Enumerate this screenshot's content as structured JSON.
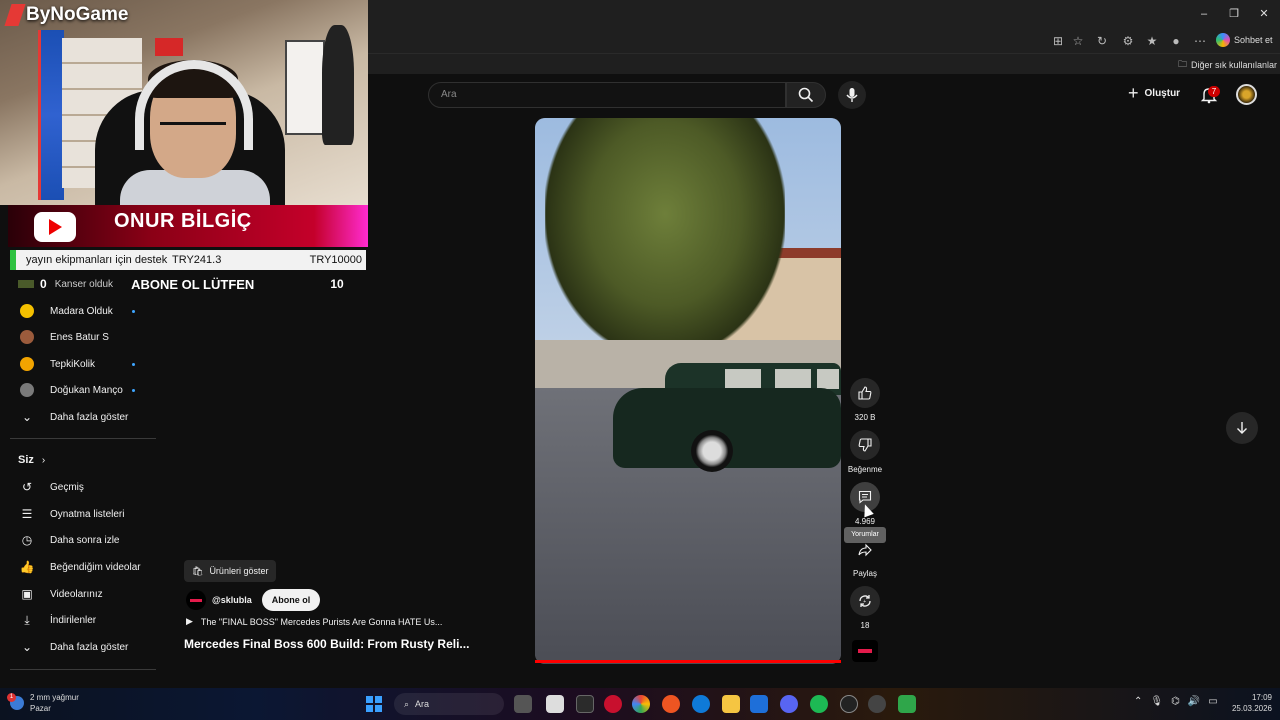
{
  "overlay": {
    "brand": "ByNoGame",
    "streamer_name": "ONUR BİLGİÇ",
    "donation_goal": "yayın ekipmanları için destek",
    "donation_current": "TRY241.3",
    "donation_target": "TRY10000",
    "sub_count_left": "0",
    "sub_goal_label": "Kanser olduk",
    "sub_cta": "ABONE OL LÜTFEN",
    "sub_count_right": "10"
  },
  "browser": {
    "copilot_label": "Sohbet et",
    "other_bookmarks": "Diğer sık kullanılanlar"
  },
  "header": {
    "search_placeholder": "Ara",
    "create_label": "Oluştur",
    "notification_count": "7"
  },
  "sidebar": {
    "subscriptions": [
      {
        "label": "Madara Olduk",
        "live": true,
        "color": "#f4c000"
      },
      {
        "label": "Enes Batur S",
        "live": false,
        "color": "#9b5b3c"
      },
      {
        "label": "TepkiKolik",
        "live": true,
        "color": "#f2a400"
      },
      {
        "label": "Doğukan Manço",
        "live": true,
        "color": "#7a7a7a"
      }
    ],
    "show_more_1": "Daha fazla göster",
    "you_section": "Siz",
    "you_items": [
      {
        "label": "Geçmiş",
        "icon": "history-icon"
      },
      {
        "label": "Oynatma listeleri",
        "icon": "playlist-icon"
      },
      {
        "label": "Daha sonra izle",
        "icon": "clock-icon"
      },
      {
        "label": "Beğendiğim videolar",
        "icon": "thumb-up-icon"
      },
      {
        "label": "Videolarınız",
        "icon": "video-icon"
      },
      {
        "label": "İndirilenler",
        "icon": "download-icon"
      }
    ],
    "show_more_2": "Daha fazla göster"
  },
  "short": {
    "products_label": "Ürünleri göster",
    "channel_handle": "@sklubla",
    "subscribe_label": "Abone ol",
    "playlist_text": "The \"FINAL BOSS\" Mercedes Purists Are Gonna HATE Us...",
    "title": "Mercedes Final Boss 600 Build: From Rusty Reli...",
    "likes": "320 B",
    "dislike_label": "Beğenme",
    "comments": "4.969",
    "comments_tooltip": "Yorumlar",
    "share_label": "Paylaş",
    "remix_count": "18"
  },
  "taskbar": {
    "weather_text": "2 mm yağmur",
    "weather_day": "Pazar",
    "weather_badge": "1",
    "search_label": "Ara",
    "time": "17:09",
    "date": "25.03.2026"
  },
  "colors": {
    "accent_red": "#ff0000",
    "subscribe_bg": "#f1f1f1",
    "background": "#0f0f0f"
  }
}
